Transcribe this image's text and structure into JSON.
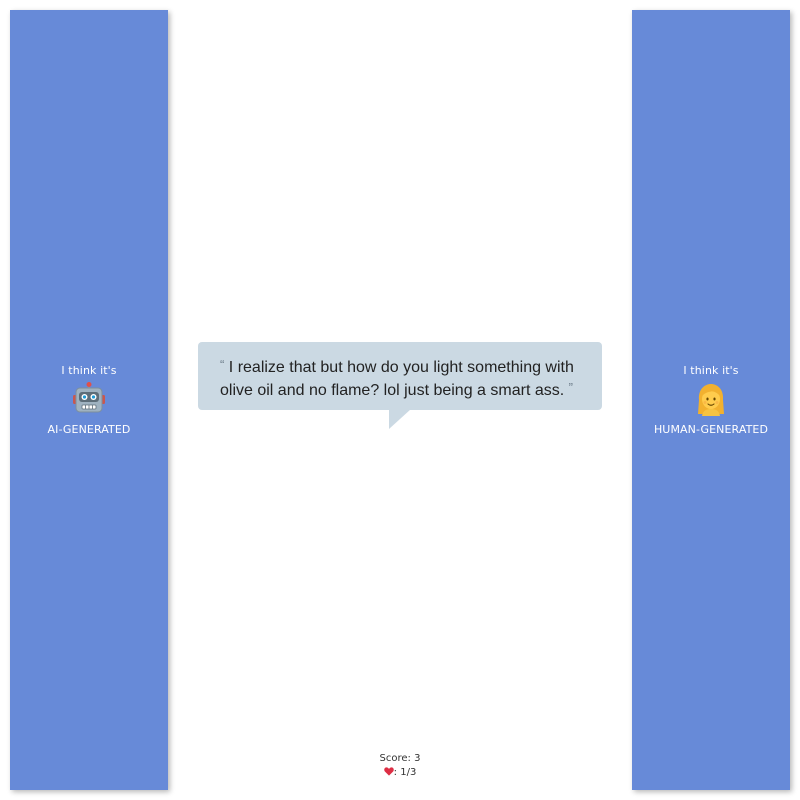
{
  "left_choice": {
    "prompt": "I think it's",
    "label": "AI-GENERATED",
    "icon": "robot-icon",
    "bg_color": "#678ad8"
  },
  "right_choice": {
    "prompt": "I think it's",
    "label": "HUMAN-GENERATED",
    "icon": "woman-icon",
    "bg_color": "#678ad8"
  },
  "quote": {
    "open_mark": "“",
    "text": "I realize that but how do you light something with olive oil and no flame? lol just being a smart ass.",
    "close_mark": "”"
  },
  "status": {
    "score_text": "Score: 3",
    "lives_text": ": 1/3",
    "lives_icon": "heart-icon"
  }
}
